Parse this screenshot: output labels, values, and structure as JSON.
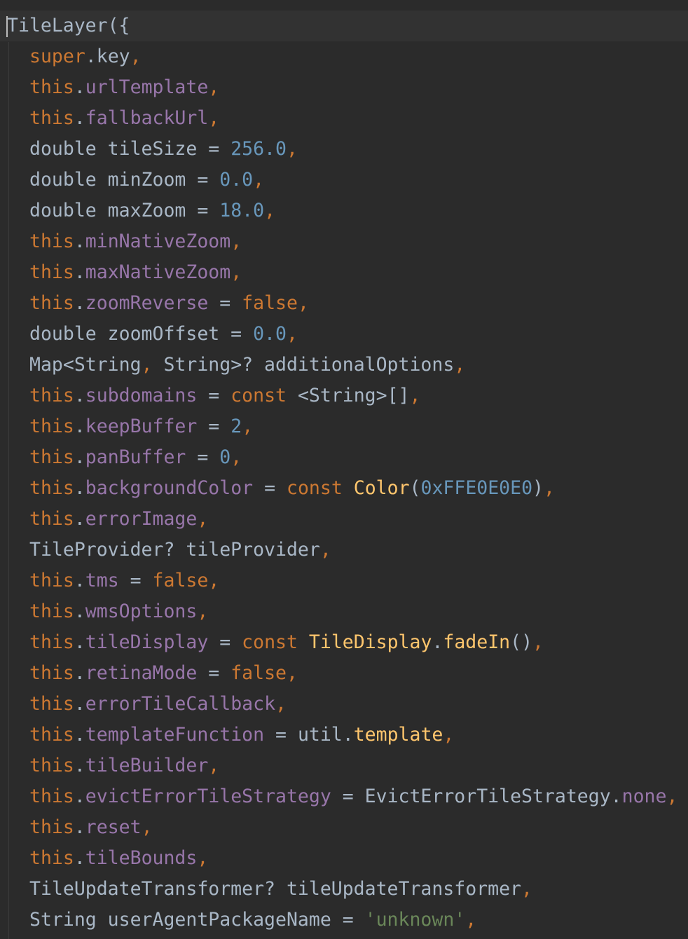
{
  "editor": {
    "theme_colors": {
      "background": "#2b2b2b",
      "current_line": "#323232",
      "text": "#a9b7c6",
      "keyword": "#cc7832",
      "field": "#9876aa",
      "number": "#6897bb",
      "string": "#6a8759",
      "call": "#ffc66d"
    },
    "lines": [
      {
        "indent": false,
        "current": true,
        "tokens": [
          {
            "t": "text",
            "v": "TileLayer({"
          }
        ]
      },
      {
        "indent": true,
        "tokens": [
          {
            "t": "keyword",
            "v": "super"
          },
          {
            "t": "text",
            "v": ".key"
          },
          {
            "t": "comma",
            "v": ","
          }
        ]
      },
      {
        "indent": true,
        "tokens": [
          {
            "t": "keyword",
            "v": "this"
          },
          {
            "t": "text",
            "v": "."
          },
          {
            "t": "field",
            "v": "urlTemplate"
          },
          {
            "t": "comma",
            "v": ","
          }
        ]
      },
      {
        "indent": true,
        "tokens": [
          {
            "t": "keyword",
            "v": "this"
          },
          {
            "t": "text",
            "v": "."
          },
          {
            "t": "field",
            "v": "fallbackUrl"
          },
          {
            "t": "comma",
            "v": ","
          }
        ]
      },
      {
        "indent": true,
        "tokens": [
          {
            "t": "text",
            "v": "double tileSize = "
          },
          {
            "t": "number",
            "v": "256.0"
          },
          {
            "t": "comma",
            "v": ","
          }
        ]
      },
      {
        "indent": true,
        "tokens": [
          {
            "t": "text",
            "v": "double minZoom = "
          },
          {
            "t": "number",
            "v": "0.0"
          },
          {
            "t": "comma",
            "v": ","
          }
        ]
      },
      {
        "indent": true,
        "tokens": [
          {
            "t": "text",
            "v": "double maxZoom = "
          },
          {
            "t": "number",
            "v": "18.0"
          },
          {
            "t": "comma",
            "v": ","
          }
        ]
      },
      {
        "indent": true,
        "tokens": [
          {
            "t": "keyword",
            "v": "this"
          },
          {
            "t": "text",
            "v": "."
          },
          {
            "t": "field",
            "v": "minNativeZoom"
          },
          {
            "t": "comma",
            "v": ","
          }
        ]
      },
      {
        "indent": true,
        "tokens": [
          {
            "t": "keyword",
            "v": "this"
          },
          {
            "t": "text",
            "v": "."
          },
          {
            "t": "field",
            "v": "maxNativeZoom"
          },
          {
            "t": "comma",
            "v": ","
          }
        ]
      },
      {
        "indent": true,
        "tokens": [
          {
            "t": "keyword",
            "v": "this"
          },
          {
            "t": "text",
            "v": "."
          },
          {
            "t": "field",
            "v": "zoomReverse"
          },
          {
            "t": "text",
            "v": " = "
          },
          {
            "t": "keyword",
            "v": "false"
          },
          {
            "t": "comma",
            "v": ","
          }
        ]
      },
      {
        "indent": true,
        "tokens": [
          {
            "t": "text",
            "v": "double zoomOffset = "
          },
          {
            "t": "number",
            "v": "0.0"
          },
          {
            "t": "comma",
            "v": ","
          }
        ]
      },
      {
        "indent": true,
        "tokens": [
          {
            "t": "text",
            "v": "Map<String"
          },
          {
            "t": "comma",
            "v": ","
          },
          {
            "t": "text",
            "v": " String>? additionalOptions"
          },
          {
            "t": "comma",
            "v": ","
          }
        ]
      },
      {
        "indent": true,
        "tokens": [
          {
            "t": "keyword",
            "v": "this"
          },
          {
            "t": "text",
            "v": "."
          },
          {
            "t": "field",
            "v": "subdomains"
          },
          {
            "t": "text",
            "v": " = "
          },
          {
            "t": "keyword",
            "v": "const"
          },
          {
            "t": "text",
            "v": " <String>[]"
          },
          {
            "t": "comma",
            "v": ","
          }
        ]
      },
      {
        "indent": true,
        "tokens": [
          {
            "t": "keyword",
            "v": "this"
          },
          {
            "t": "text",
            "v": "."
          },
          {
            "t": "field",
            "v": "keepBuffer"
          },
          {
            "t": "text",
            "v": " = "
          },
          {
            "t": "number",
            "v": "2"
          },
          {
            "t": "comma",
            "v": ","
          }
        ]
      },
      {
        "indent": true,
        "tokens": [
          {
            "t": "keyword",
            "v": "this"
          },
          {
            "t": "text",
            "v": "."
          },
          {
            "t": "field",
            "v": "panBuffer"
          },
          {
            "t": "text",
            "v": " = "
          },
          {
            "t": "number",
            "v": "0"
          },
          {
            "t": "comma",
            "v": ","
          }
        ]
      },
      {
        "indent": true,
        "tokens": [
          {
            "t": "keyword",
            "v": "this"
          },
          {
            "t": "text",
            "v": "."
          },
          {
            "t": "field",
            "v": "backgroundColor"
          },
          {
            "t": "text",
            "v": " = "
          },
          {
            "t": "keyword",
            "v": "const"
          },
          {
            "t": "text",
            "v": " "
          },
          {
            "t": "call",
            "v": "Color"
          },
          {
            "t": "text",
            "v": "("
          },
          {
            "t": "number",
            "v": "0xFFE0E0E0"
          },
          {
            "t": "text",
            "v": ")"
          },
          {
            "t": "comma",
            "v": ","
          }
        ]
      },
      {
        "indent": true,
        "tokens": [
          {
            "t": "keyword",
            "v": "this"
          },
          {
            "t": "text",
            "v": "."
          },
          {
            "t": "field",
            "v": "errorImage"
          },
          {
            "t": "comma",
            "v": ","
          }
        ]
      },
      {
        "indent": true,
        "tokens": [
          {
            "t": "text",
            "v": "TileProvider? tileProvider"
          },
          {
            "t": "comma",
            "v": ","
          }
        ]
      },
      {
        "indent": true,
        "tokens": [
          {
            "t": "keyword",
            "v": "this"
          },
          {
            "t": "text",
            "v": "."
          },
          {
            "t": "field",
            "v": "tms"
          },
          {
            "t": "text",
            "v": " = "
          },
          {
            "t": "keyword",
            "v": "false"
          },
          {
            "t": "comma",
            "v": ","
          }
        ]
      },
      {
        "indent": true,
        "tokens": [
          {
            "t": "keyword",
            "v": "this"
          },
          {
            "t": "text",
            "v": "."
          },
          {
            "t": "field",
            "v": "wmsOptions"
          },
          {
            "t": "comma",
            "v": ","
          }
        ]
      },
      {
        "indent": true,
        "tokens": [
          {
            "t": "keyword",
            "v": "this"
          },
          {
            "t": "text",
            "v": "."
          },
          {
            "t": "field",
            "v": "tileDisplay"
          },
          {
            "t": "text",
            "v": " = "
          },
          {
            "t": "keyword",
            "v": "const"
          },
          {
            "t": "text",
            "v": " "
          },
          {
            "t": "call",
            "v": "TileDisplay"
          },
          {
            "t": "text",
            "v": "."
          },
          {
            "t": "call",
            "v": "fadeIn"
          },
          {
            "t": "text",
            "v": "()"
          },
          {
            "t": "comma",
            "v": ","
          }
        ]
      },
      {
        "indent": true,
        "tokens": [
          {
            "t": "keyword",
            "v": "this"
          },
          {
            "t": "text",
            "v": "."
          },
          {
            "t": "field",
            "v": "retinaMode"
          },
          {
            "t": "text",
            "v": " = "
          },
          {
            "t": "keyword",
            "v": "false"
          },
          {
            "t": "comma",
            "v": ","
          }
        ]
      },
      {
        "indent": true,
        "tokens": [
          {
            "t": "keyword",
            "v": "this"
          },
          {
            "t": "text",
            "v": "."
          },
          {
            "t": "field",
            "v": "errorTileCallback"
          },
          {
            "t": "comma",
            "v": ","
          }
        ]
      },
      {
        "indent": true,
        "tokens": [
          {
            "t": "keyword",
            "v": "this"
          },
          {
            "t": "text",
            "v": "."
          },
          {
            "t": "field",
            "v": "templateFunction"
          },
          {
            "t": "text",
            "v": " = util."
          },
          {
            "t": "call",
            "v": "template"
          },
          {
            "t": "comma",
            "v": ","
          }
        ]
      },
      {
        "indent": true,
        "tokens": [
          {
            "t": "keyword",
            "v": "this"
          },
          {
            "t": "text",
            "v": "."
          },
          {
            "t": "field",
            "v": "tileBuilder"
          },
          {
            "t": "comma",
            "v": ","
          }
        ]
      },
      {
        "indent": true,
        "tokens": [
          {
            "t": "keyword",
            "v": "this"
          },
          {
            "t": "text",
            "v": "."
          },
          {
            "t": "field",
            "v": "evictErrorTileStrategy"
          },
          {
            "t": "text",
            "v": " = EvictErrorTileStrategy."
          },
          {
            "t": "field",
            "v": "none"
          },
          {
            "t": "comma",
            "v": ","
          }
        ]
      },
      {
        "indent": true,
        "tokens": [
          {
            "t": "keyword",
            "v": "this"
          },
          {
            "t": "text",
            "v": "."
          },
          {
            "t": "field",
            "v": "reset"
          },
          {
            "t": "comma",
            "v": ","
          }
        ]
      },
      {
        "indent": true,
        "tokens": [
          {
            "t": "keyword",
            "v": "this"
          },
          {
            "t": "text",
            "v": "."
          },
          {
            "t": "field",
            "v": "tileBounds"
          },
          {
            "t": "comma",
            "v": ","
          }
        ]
      },
      {
        "indent": true,
        "tokens": [
          {
            "t": "text",
            "v": "TileUpdateTransformer? tileUpdateTransformer"
          },
          {
            "t": "comma",
            "v": ","
          }
        ]
      },
      {
        "indent": true,
        "tokens": [
          {
            "t": "text",
            "v": "String userAgentPackageName = "
          },
          {
            "t": "string",
            "v": "'unknown'"
          },
          {
            "t": "comma",
            "v": ","
          }
        ]
      }
    ]
  }
}
